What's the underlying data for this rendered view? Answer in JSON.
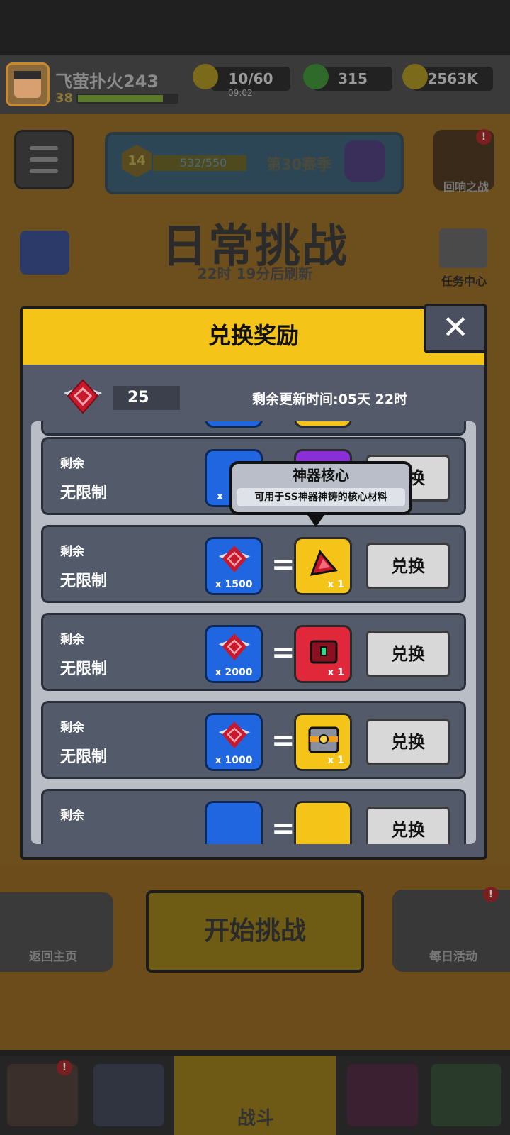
{
  "header": {
    "username": "飞萤扑火243",
    "level": "38",
    "stamina": "10/60",
    "stamina_timer": "09:02",
    "gems": "315",
    "gold": "2563K"
  },
  "season": {
    "level": "14",
    "progress": "532/550",
    "label": "第30赛季"
  },
  "side_buttons": {
    "echo_battle": "回响之战",
    "task_center": "任务中心"
  },
  "background": {
    "title": "日常挑战",
    "refresh": "22时 19分后刷新"
  },
  "modal": {
    "title": "兑换奖励",
    "close_glyph": "✕",
    "token_count": "25",
    "timer": "剩余更新时间:05天 22时",
    "rows": [
      {
        "remaining_label": "剩余",
        "remaining_value": "无限制",
        "cost_qty": "x",
        "reward_qty": "",
        "button": "兑换",
        "reward_color": "#8a2fd8"
      },
      {
        "remaining_label": "剩余",
        "remaining_value": "无限制",
        "cost_qty": "x 1500",
        "reward_qty": "x 1",
        "button": "兑换",
        "reward_color": "#f5c418"
      },
      {
        "remaining_label": "剩余",
        "remaining_value": "无限制",
        "cost_qty": "x 2000",
        "reward_qty": "x 1",
        "button": "兑换",
        "reward_color": "#e0283a"
      },
      {
        "remaining_label": "剩余",
        "remaining_value": "无限制",
        "cost_qty": "x 1000",
        "reward_qty": "x 1",
        "button": "兑换",
        "reward_color": "#f5c418"
      },
      {
        "remaining_label": "剩余",
        "remaining_value": "",
        "cost_qty": "",
        "reward_qty": "",
        "button": "兑换",
        "reward_color": "#f5c418"
      }
    ],
    "tooltip": {
      "title": "神器核心",
      "desc": "可用于SS神器神铸的核心材料"
    }
  },
  "bottom": {
    "back_label": "返回主页",
    "start_label": "开始挑战",
    "daily_label": "每日活动",
    "nav_active_label": "战斗"
  }
}
